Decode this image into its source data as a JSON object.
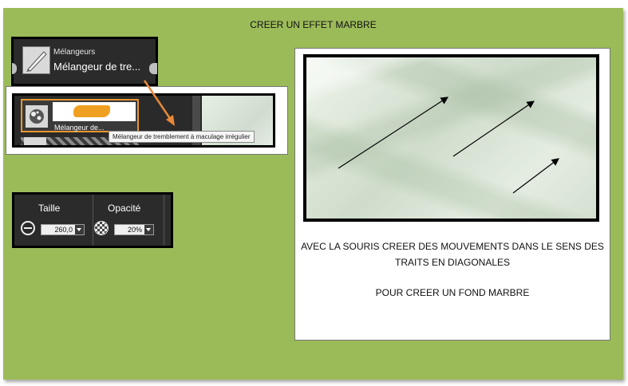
{
  "page": {
    "title": "CREER UN EFFET MARBRE"
  },
  "brush_panel": {
    "category": "Mélangeurs",
    "brush_name": "Mélangeur de tre..."
  },
  "variants": {
    "selected_label": "Mélangeur de...",
    "tooltip": "Mélangeur de tremblement à maculage irrégulier"
  },
  "size_panel": {
    "size_label": "Taille",
    "size_value": "260,0",
    "opacity_label": "Opacité",
    "opacity_value": "20%"
  },
  "instructions": {
    "line1": "AVEC LA SOURIS CREER DES MOUVEMENTS DANS LE SENS DES TRAITS EN DIAGONALES",
    "line2": "POUR CREER UN FOND MARBRE"
  },
  "colors": {
    "background": "#9bbb59",
    "annotation_arrow": "#e8893a",
    "selection_border": "#e8962f"
  }
}
